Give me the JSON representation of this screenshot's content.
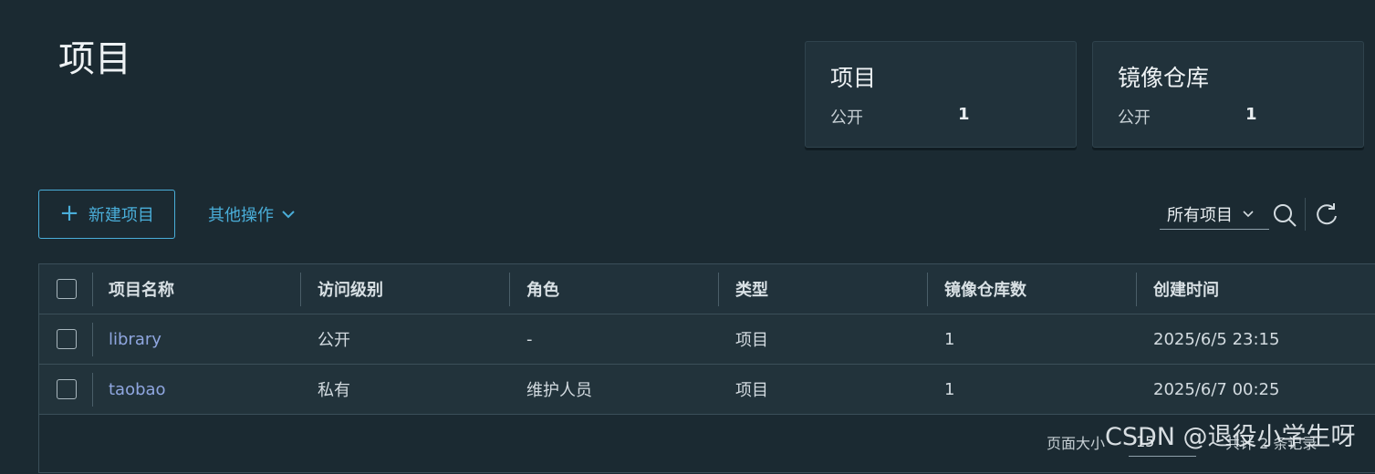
{
  "page": {
    "title": "项目"
  },
  "summary_cards": [
    {
      "title": "项目",
      "label": "公开",
      "count": "1"
    },
    {
      "title": "镜像仓库",
      "label": "公开",
      "count": "1"
    }
  ],
  "toolbar": {
    "new_project_label": "新建项目",
    "more_actions_label": "其他操作",
    "filter_value": "所有项目"
  },
  "table": {
    "headers": [
      "项目名称",
      "访问级别",
      "角色",
      "类型",
      "镜像仓库数",
      "创建时间"
    ],
    "rows": [
      [
        "library",
        "公开",
        "-",
        "项目",
        "1",
        "2025/6/5 23:15"
      ],
      [
        "taobao",
        "私有",
        "维护人员",
        "项目",
        "1",
        "2025/6/7 00:25"
      ]
    ],
    "footer": {
      "page_size_label": "页面大小",
      "page_size_value": "15",
      "total_text": "共计 2 条记录"
    }
  },
  "watermark": "CSDN @退役小学生呀",
  "colors": {
    "background": "#1b2a32",
    "card": "#21323b",
    "accent": "#4aaed9",
    "link": "#8fa6df"
  }
}
